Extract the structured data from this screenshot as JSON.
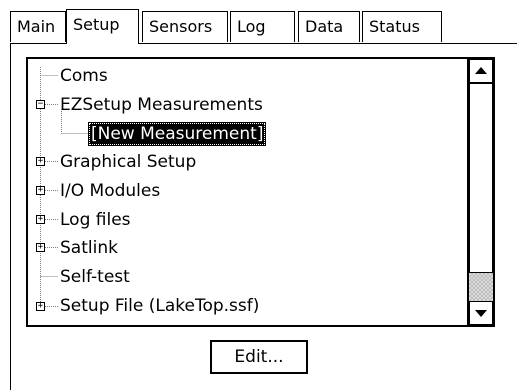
{
  "tabs": [
    {
      "label": "Main",
      "active": false
    },
    {
      "label": "Setup",
      "active": true
    },
    {
      "label": "Sensors",
      "active": false
    },
    {
      "label": "Log",
      "active": false
    },
    {
      "label": "Data",
      "active": false
    },
    {
      "label": "Status",
      "active": false
    }
  ],
  "tree": {
    "items": [
      {
        "label": "Coms",
        "expander": "none"
      },
      {
        "label": "EZSetup Measurements",
        "expander": "minus"
      },
      {
        "label": "[New Measurement]",
        "expander": "none",
        "selected": true
      },
      {
        "label": "Graphical Setup",
        "expander": "plus"
      },
      {
        "label": "I/O Modules",
        "expander": "plus"
      },
      {
        "label": "Log files",
        "expander": "plus"
      },
      {
        "label": "Satlink",
        "expander": "plus"
      },
      {
        "label": "Self-test",
        "expander": "none"
      },
      {
        "label": "Setup File (LakeTop.ssf)",
        "expander": "plus"
      }
    ]
  },
  "icons": {
    "scroll_up": "up-arrow-icon",
    "scroll_down": "down-arrow-icon",
    "expand": "plus-icon",
    "collapse": "minus-icon"
  },
  "edit_button": {
    "label": "Edit..."
  }
}
